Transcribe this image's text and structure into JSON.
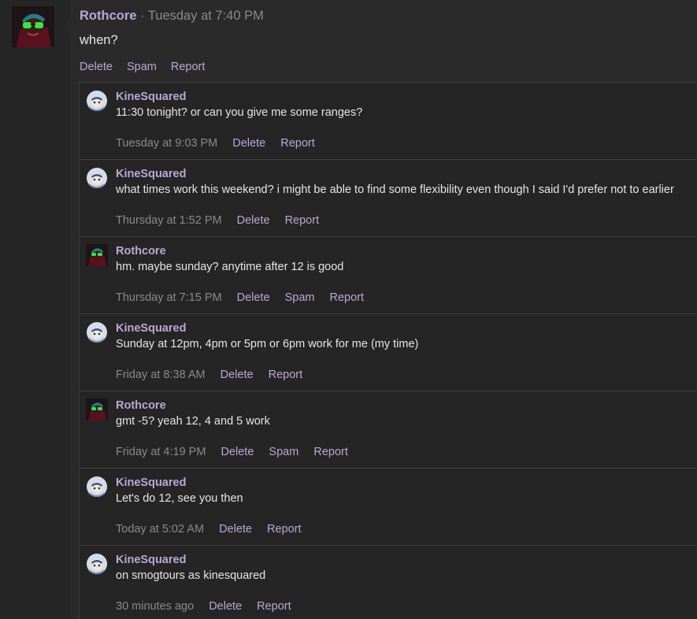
{
  "post": {
    "author": "Rothcore",
    "separator": "·",
    "time": "Tuesday at 7:40 PM",
    "text": "when?",
    "actions": [
      "Delete",
      "Spam",
      "Report"
    ]
  },
  "comments": [
    {
      "author": "KineSquared",
      "avatar": "kine",
      "text": "11:30 tonight? or can you give me some ranges?",
      "time": "Tuesday at 9:03 PM",
      "actions": [
        "Delete",
        "Report"
      ]
    },
    {
      "author": "KineSquared",
      "avatar": "kine",
      "text": "what times work this weekend? i might be able to find some flexibility even though I said I'd prefer not to earlier",
      "time": "Thursday at 1:52 PM",
      "actions": [
        "Delete",
        "Report"
      ]
    },
    {
      "author": "Rothcore",
      "avatar": "roth",
      "text": "hm. maybe sunday? anytime after 12 is good",
      "time": "Thursday at 7:15 PM",
      "actions": [
        "Delete",
        "Spam",
        "Report"
      ]
    },
    {
      "author": "KineSquared",
      "avatar": "kine",
      "text": "Sunday at 12pm, 4pm or 5pm or 6pm work for me (my time)",
      "time": "Friday at 8:38 AM",
      "actions": [
        "Delete",
        "Report"
      ]
    },
    {
      "author": "Rothcore",
      "avatar": "roth",
      "text": "gmt -5? yeah 12, 4 and 5 work",
      "time": "Friday at 4:19 PM",
      "actions": [
        "Delete",
        "Spam",
        "Report"
      ]
    },
    {
      "author": "KineSquared",
      "avatar": "kine",
      "text": "Let's do 12, see you then",
      "time": "Today at 5:02 AM",
      "actions": [
        "Delete",
        "Report"
      ]
    },
    {
      "author": "KineSquared",
      "avatar": "kine",
      "text": "on smogtours as kinesquared",
      "time": "30 minutes ago",
      "actions": [
        "Delete",
        "Report"
      ]
    }
  ],
  "colors": {
    "accent": "#b9a9d8",
    "muted": "#8a8a8a",
    "text": "#e6e6e6"
  }
}
